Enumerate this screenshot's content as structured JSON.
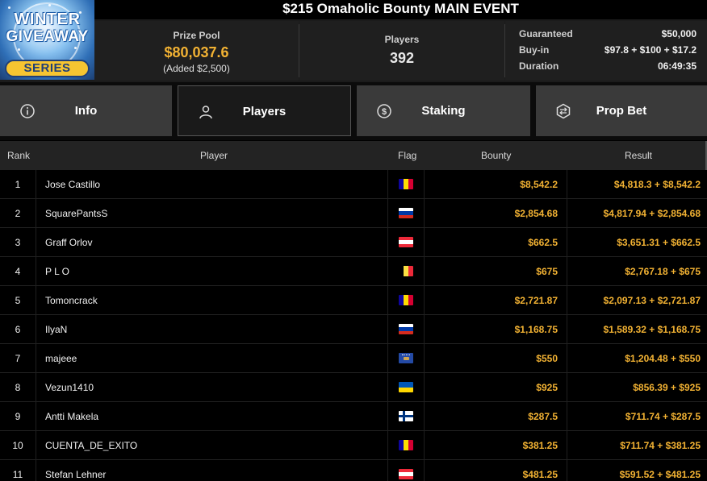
{
  "logo": {
    "line1": "WINTER",
    "line2": "GIVEAWAY",
    "line3": "SERIES"
  },
  "title": "$215 Omaholic Bounty MAIN EVENT",
  "prize_pool": {
    "label": "Prize Pool",
    "value": "$80,037.6",
    "added": "(Added $2,500)"
  },
  "players_stat": {
    "label": "Players",
    "value": "392"
  },
  "details": [
    {
      "key": "Guaranteed",
      "value": "$50,000"
    },
    {
      "key": "Buy-in",
      "value": "$97.8 + $100 + $17.2"
    },
    {
      "key": "Duration",
      "value": "06:49:35"
    }
  ],
  "tabs": [
    {
      "label": "Info",
      "icon": "info-icon",
      "active": false
    },
    {
      "label": "Players",
      "icon": "user-icon",
      "active": true
    },
    {
      "label": "Staking",
      "icon": "dollar-coin-icon",
      "active": false
    },
    {
      "label": "Prop Bet",
      "icon": "prop-bet-icon",
      "active": false
    }
  ],
  "table": {
    "headers": {
      "rank": "Rank",
      "player": "Player",
      "flag": "Flag",
      "bounty": "Bounty",
      "result": "Result"
    },
    "rows": [
      {
        "rank": "1",
        "player": "Jose Castillo",
        "flag": "andorra",
        "bounty": "$8,542.2",
        "result": "$4,818.3 + $8,542.2"
      },
      {
        "rank": "2",
        "player": "SquarePantsS",
        "flag": "russia",
        "bounty": "$2,854.68",
        "result": "$4,817.94 + $2,854.68"
      },
      {
        "rank": "3",
        "player": "Graff Orlov",
        "flag": "austria",
        "bounty": "$662.5",
        "result": "$3,651.31 + $662.5"
      },
      {
        "rank": "4",
        "player": "P L O",
        "flag": "belgium",
        "bounty": "$675",
        "result": "$2,767.18 + $675"
      },
      {
        "rank": "5",
        "player": "Tomoncrack",
        "flag": "andorra",
        "bounty": "$2,721.87",
        "result": "$2,097.13 + $2,721.87"
      },
      {
        "rank": "6",
        "player": "IlyaN",
        "flag": "russia",
        "bounty": "$1,168.75",
        "result": "$1,589.32 + $1,168.75"
      },
      {
        "rank": "7",
        "player": "majeee",
        "flag": "kosovo",
        "bounty": "$550",
        "result": "$1,204.48 + $550"
      },
      {
        "rank": "8",
        "player": "Vezun1410",
        "flag": "ukraine",
        "bounty": "$925",
        "result": "$856.39 + $925"
      },
      {
        "rank": "9",
        "player": "Antti Makela",
        "flag": "finland",
        "bounty": "$287.5",
        "result": "$711.74 + $287.5"
      },
      {
        "rank": "10",
        "player": "CUENTA_DE_EXITO",
        "flag": "andorra",
        "bounty": "$381.25",
        "result": "$711.74 + $381.25"
      },
      {
        "rank": "11",
        "player": "Stefan Lehner",
        "flag": "austria",
        "bounty": "$481.25",
        "result": "$591.52 + $481.25"
      }
    ]
  },
  "colors": {
    "accent_gold": "#f2b233",
    "background": "#000000",
    "tab_bg": "#3a3a3a",
    "tab_active_bg": "#1a1a1a"
  }
}
